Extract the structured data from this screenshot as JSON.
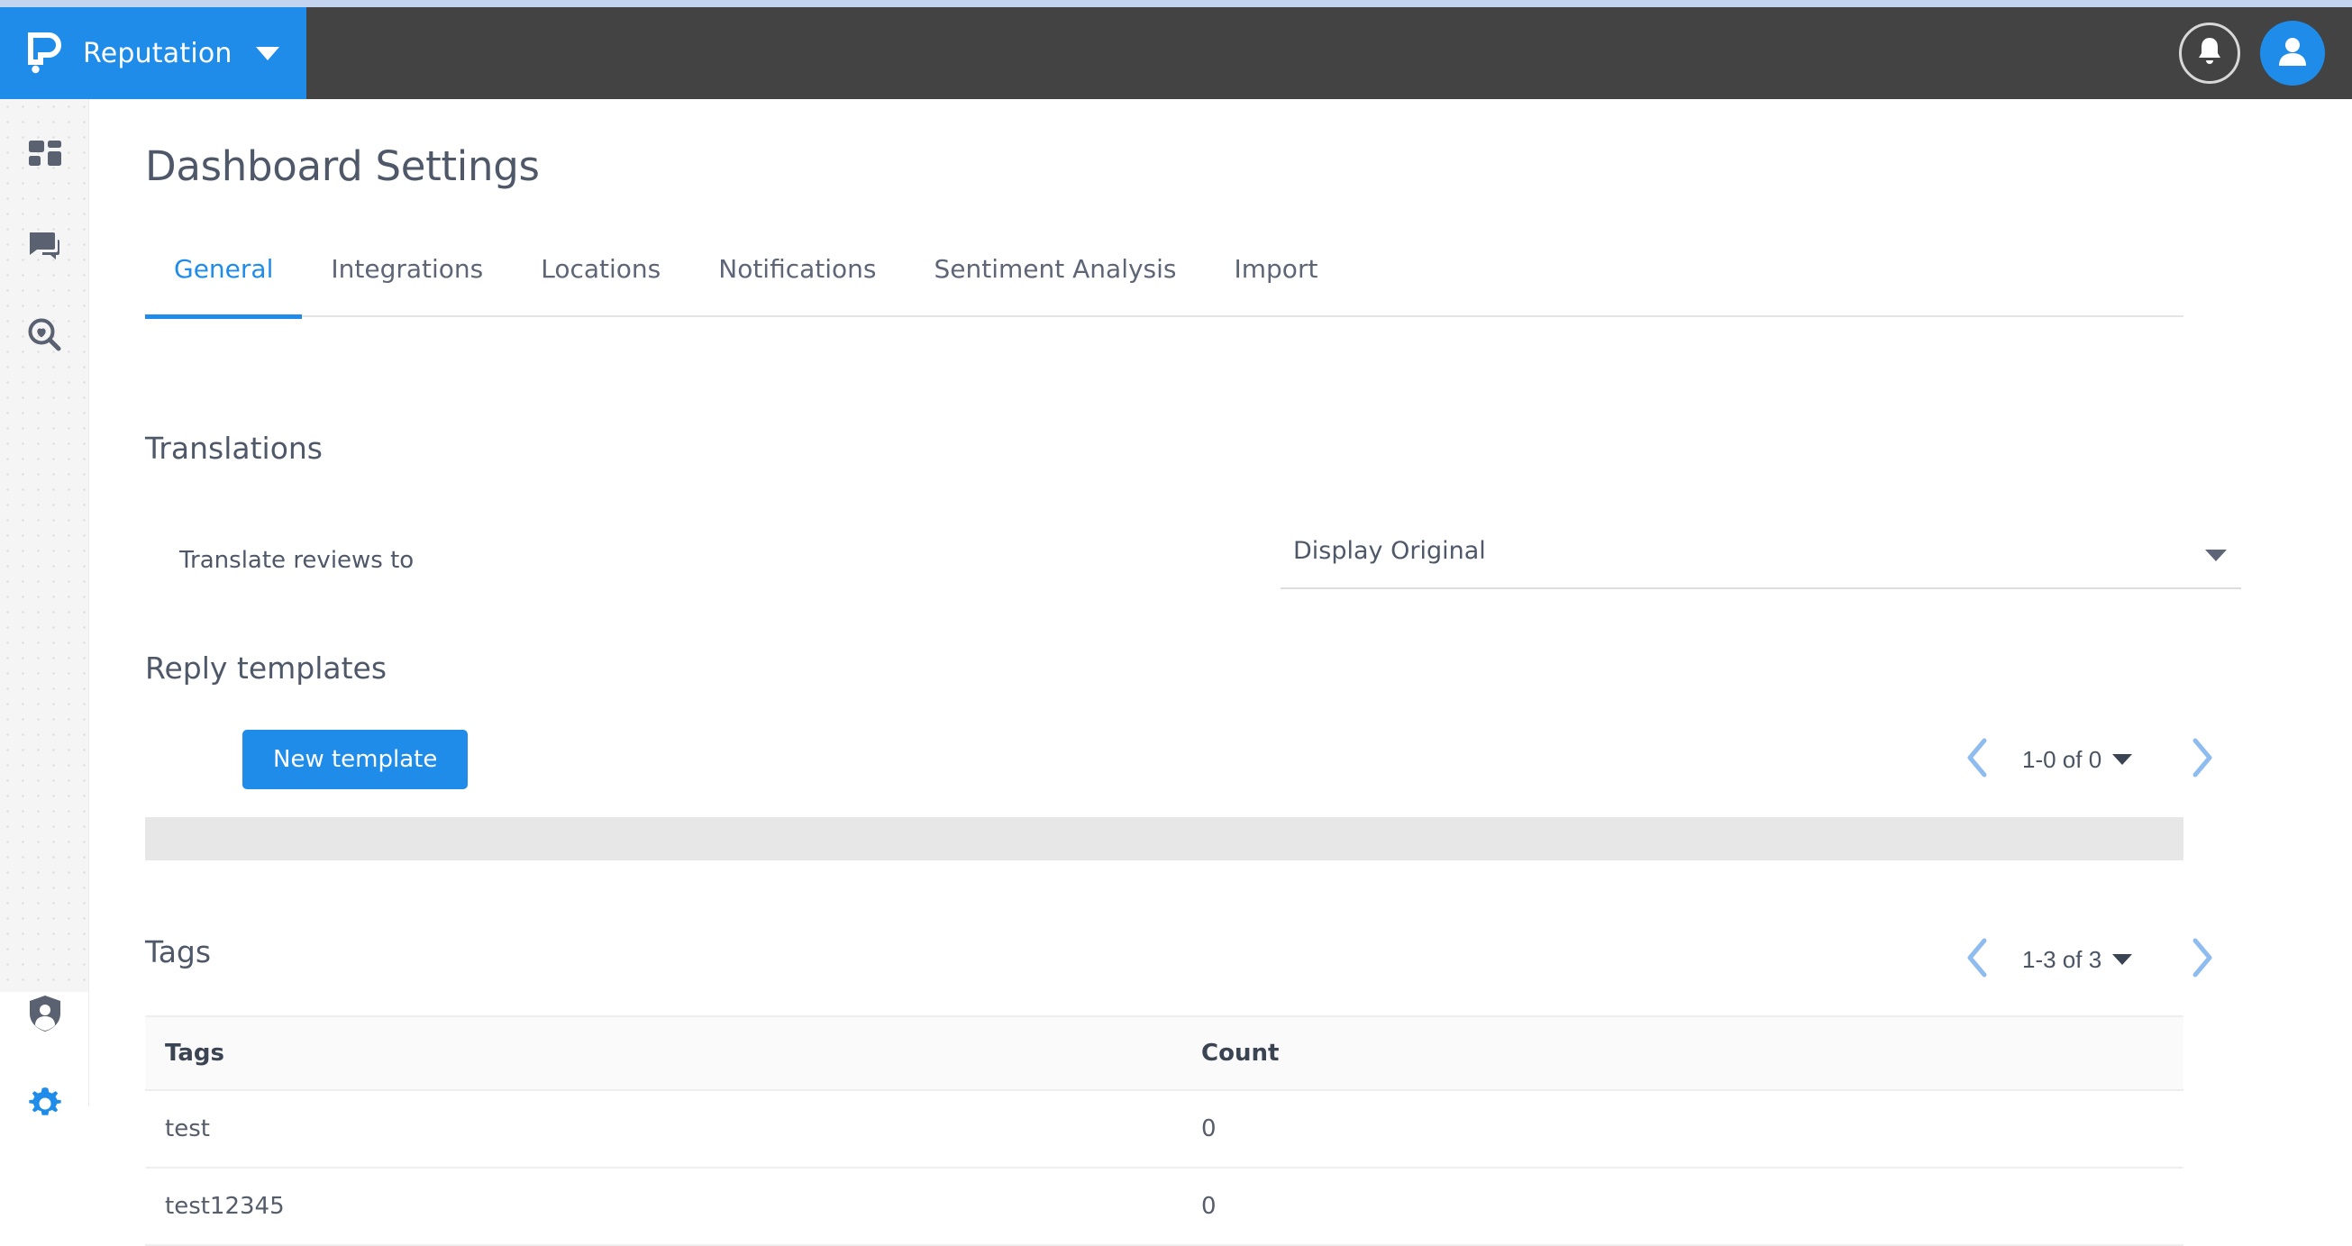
{
  "brand": {
    "name": "Reputation",
    "logo_icon": "reputation-p-logo",
    "caret_icon": "chevron-down-icon"
  },
  "topbar": {
    "notifications_icon": "bell-icon",
    "avatar_icon": "user-avatar-icon"
  },
  "sidebar": {
    "items": [
      {
        "name": "dashboard",
        "icon": "dashboard-grid-icon",
        "active": false
      },
      {
        "name": "reviews",
        "icon": "chat-bubbles-icon",
        "active": false
      },
      {
        "name": "insights",
        "icon": "magnifier-heart-icon",
        "active": false
      },
      {
        "name": "admin",
        "icon": "shield-person-icon",
        "active": false
      },
      {
        "name": "settings",
        "icon": "gear-icon",
        "active": true
      }
    ]
  },
  "page": {
    "title": "Dashboard Settings"
  },
  "tabs": [
    {
      "label": "General",
      "active": true
    },
    {
      "label": "Integrations",
      "active": false
    },
    {
      "label": "Locations",
      "active": false
    },
    {
      "label": "Notifications",
      "active": false
    },
    {
      "label": "Sentiment Analysis",
      "active": false
    },
    {
      "label": "Import",
      "active": false
    }
  ],
  "translations": {
    "heading": "Translations",
    "field_label": "Translate reviews to",
    "selected_value": "Display Original",
    "caret_icon": "dropdown-caret-icon"
  },
  "reply_templates": {
    "heading": "Reply templates",
    "new_button": "New template",
    "pagination": {
      "range": "1-0 of 0",
      "prev_icon": "chevron-left-icon",
      "next_icon": "chevron-right-icon",
      "caret_icon": "dropdown-caret-icon"
    }
  },
  "tags": {
    "heading": "Tags",
    "pagination": {
      "range": "1-3 of 3",
      "prev_icon": "chevron-left-icon",
      "next_icon": "chevron-right-icon",
      "caret_icon": "dropdown-caret-icon"
    },
    "columns": [
      "Tags",
      "Count"
    ],
    "rows": [
      {
        "tag": "test",
        "count": "0"
      },
      {
        "tag": "test12345",
        "count": "0"
      }
    ]
  },
  "colors": {
    "brand_blue": "#1f8cea",
    "topbar_dark": "#434343",
    "text_slate": "#4e5869",
    "empty_bar": "#e7e7e7",
    "arrow_blue": "#8fbcee"
  }
}
